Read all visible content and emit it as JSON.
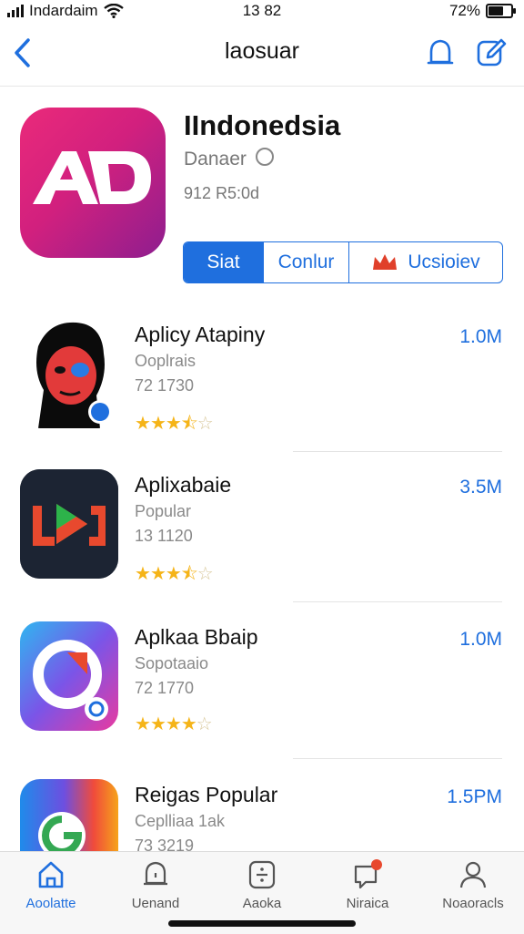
{
  "status_bar": {
    "carrier": "Indardaim",
    "time": "13 82",
    "battery": "72%",
    "battery_fraction": 0.72
  },
  "nav": {
    "title": "laosuar",
    "back_icon": "chevron-left-icon",
    "bell_icon": "bell-icon",
    "edit_icon": "compose-icon"
  },
  "featured": {
    "icon_text": "AD",
    "title": "IIndonedsia",
    "developer": "Danaer",
    "meta": "912 R5:0d",
    "buttons": [
      {
        "label": "Siat"
      },
      {
        "label": "Conlur"
      },
      {
        "label": "Ucsioiev"
      }
    ]
  },
  "apps": [
    {
      "name": "Aplicy Atapiny",
      "category": "Ooplrais",
      "count": "72 1730",
      "size": "1.0M",
      "rating": 3.5
    },
    {
      "name": "Aplixabaie",
      "category": "Popular",
      "count": "13 1120",
      "size": "3.5M",
      "rating": 3.5
    },
    {
      "name": "Aplkaa Bbaip",
      "category": "Sopotaaio",
      "count": "72 1770",
      "size": "1.0M",
      "rating": 4
    },
    {
      "name": "Reigas Popular",
      "category": "Ceplliaa 1ak",
      "count": "73 3219",
      "size": "1.5PM",
      "rating": 0
    }
  ],
  "tabs": [
    {
      "label": "Aoolatte",
      "icon": "home-icon"
    },
    {
      "label": "Uenand",
      "icon": "bell-icon"
    },
    {
      "label": "Aaoka",
      "icon": "calculator-icon"
    },
    {
      "label": "Niraica",
      "icon": "chat-notification-icon"
    },
    {
      "label": "Noaoracls",
      "icon": "person-icon"
    }
  ],
  "colors": {
    "accent": "#1f6fde",
    "star": "#f5b418",
    "hero_icon": "#d2207e"
  }
}
